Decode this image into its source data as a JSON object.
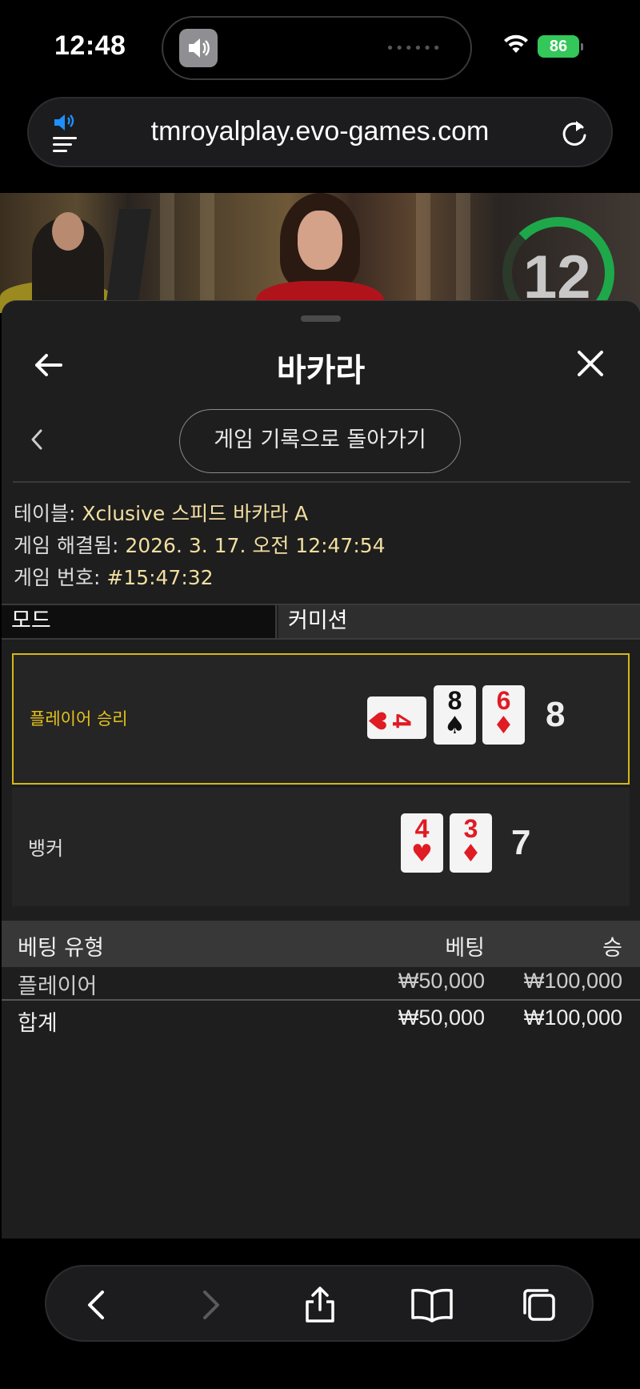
{
  "status_bar": {
    "time": "12:48",
    "battery": "86"
  },
  "browser": {
    "url": "tmroyalplay.evo-games.com"
  },
  "video": {
    "countdown": "12"
  },
  "panel": {
    "title": "바카라",
    "history_button": "게임 기록으로 돌아가기",
    "info": {
      "table_label": "테이블:",
      "table_value": "Xclusive 스피드 바카라 A",
      "resolved_label": "게임 해결됨:",
      "resolved_value": "2026. 3. 17. 오전 12:47:54",
      "number_label": "게임 번호:",
      "number_value": "#15:47:32"
    },
    "mode": {
      "left": "모드",
      "right": "커미션"
    },
    "player": {
      "label": "플레이어 승리",
      "score": "8",
      "cards": [
        {
          "rank": "4",
          "suit": "♥",
          "color": "#e01b24"
        },
        {
          "rank": "8",
          "suit": "♠",
          "color": "#111111"
        },
        {
          "rank": "6",
          "suit": "♦",
          "color": "#e01b24"
        }
      ]
    },
    "banker": {
      "label": "뱅커",
      "score": "7",
      "cards": [
        {
          "rank": "4",
          "suit": "♥",
          "color": "#e01b24"
        },
        {
          "rank": "3",
          "suit": "♦",
          "color": "#e01b24"
        }
      ]
    },
    "bets": {
      "headers": {
        "type": "베팅 유형",
        "bet": "베팅",
        "win": "승"
      },
      "rows": [
        {
          "type": "플레이어",
          "bet": "₩50,000",
          "win": "₩100,000"
        }
      ],
      "total": {
        "type": "합계",
        "bet": "₩50,000",
        "win": "₩100,000"
      }
    }
  },
  "colors": {
    "accent": "#d5b817",
    "info_value": "#f2dfa0",
    "timer": "#1ea84a"
  }
}
